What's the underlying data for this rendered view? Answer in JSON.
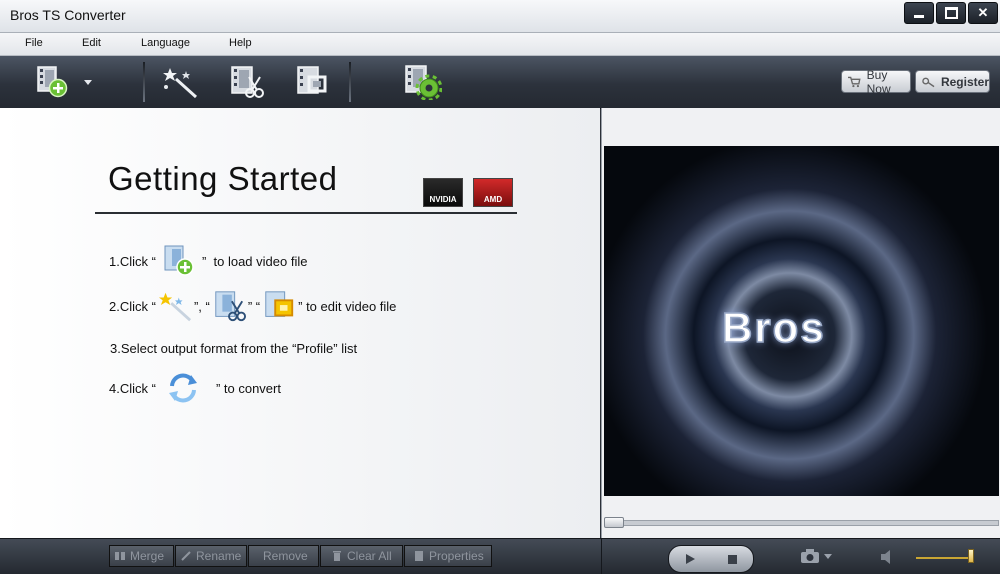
{
  "window": {
    "title": "Bros TS Converter",
    "minimize": "▁",
    "maximize": "□",
    "close": "✕"
  },
  "menu": [
    "File",
    "Edit",
    "Language",
    "Help"
  ],
  "toolbar": {
    "buy_now": "Buy Now",
    "register": "Register"
  },
  "getting_started": {
    "title": "Getting Started",
    "badges": [
      "NVIDIA",
      "AMD"
    ],
    "steps": [
      {
        "prefix": "1.Click “",
        "suffix": "”  to load video file"
      },
      {
        "prefix": "2.Click “",
        "mid1": "”, “",
        "mid2": "” “",
        "suffix": "” to edit video file"
      },
      {
        "text": "3.Select output format from the “Profile” list"
      },
      {
        "prefix": "4.Click “",
        "suffix": "” to convert"
      }
    ]
  },
  "preview": {
    "logo": "Bros"
  },
  "bottom": [
    "Merge",
    "Rename",
    "Remove",
    "Clear All",
    "Properties"
  ],
  "colors": {
    "accent_green": "#6ac035",
    "toolbar_dark": "#2c323c",
    "volume": "#c9a633"
  },
  "player": {
    "volume_level": 0.95,
    "seek_position": 0.0
  }
}
